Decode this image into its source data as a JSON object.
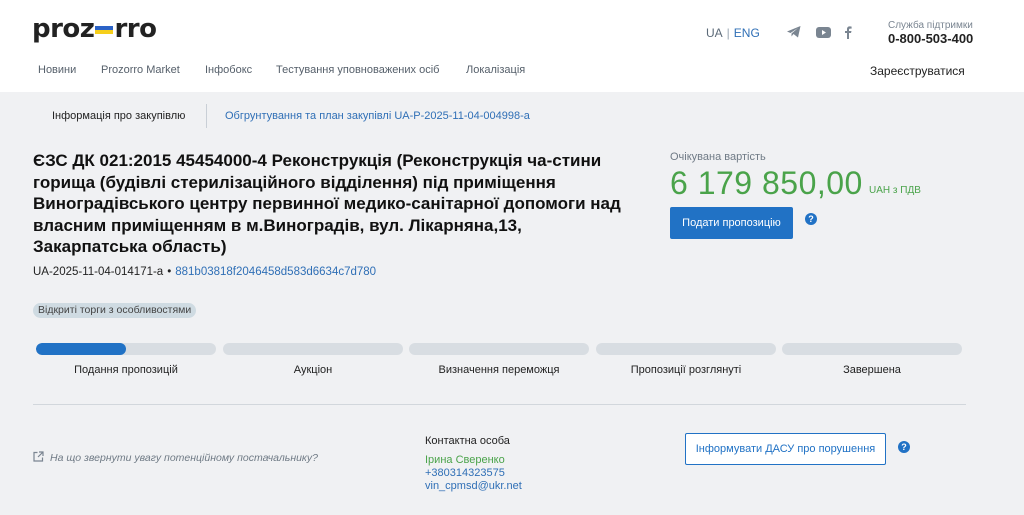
{
  "header": {
    "logo": "prozorro",
    "lang": {
      "ua": "UA",
      "eng": "ENG"
    },
    "support": {
      "label": "Служба підтримки",
      "phone": "0-800-503-400"
    },
    "nav": [
      "Новини",
      "Prozorro Market",
      "Інфобокс",
      "Тестування уповноважених осіб",
      "Локалізація"
    ],
    "register": "Зареєструватися",
    "social_icons": [
      "telegram-icon",
      "youtube-icon",
      "facebook-icon"
    ]
  },
  "tabs": {
    "info": "Інформація про закупівлю",
    "plan": "Обгрунтування та план закупівлі UA-P-2025-11-04-004998-a"
  },
  "tender": {
    "title": "ЄЗС ДК 021:2015 45454000-4 Реконструкція (Реконструкція ча-стини горища (будівлі стерилізаційного відділення) під приміщення Виноградівського центру первинної медико-санітарної допомоги над власним приміщенням в м.Виноградів, вул. Лікарняна,13, Закарпатська область)",
    "id": "UA-2025-11-04-014171-a",
    "hash": "881b03818f2046458d583d6634c7d780",
    "badge": "Відкриті торги з особливостями"
  },
  "value": {
    "label": "Очікувана вартість",
    "amount": "6 179 850,00",
    "unit": "UAH з ПДВ",
    "submit": "Подати пропозицію"
  },
  "stages": [
    {
      "label": "Подання пропозицій",
      "progress": 0.5
    },
    {
      "label": "Аукціон",
      "progress": 0
    },
    {
      "label": "Визначення переможця",
      "progress": 0
    },
    {
      "label": "Пропозиції розглянуті",
      "progress": 0
    },
    {
      "label": "Завершена",
      "progress": 0
    }
  ],
  "footer": {
    "hint": "На що звернути увагу потенційному постачальнику?",
    "contact_label": "Контактна особа",
    "contact_name": "Ірина Сверенко",
    "contact_phone": "+380314323575",
    "contact_email": "vin_cpmsd@ukr.net",
    "dasu": "Інформувати ДАСУ про порушення"
  },
  "colors": {
    "accent": "#2172c5",
    "green": "#4aa34a",
    "bg": "#f0f1f3"
  }
}
